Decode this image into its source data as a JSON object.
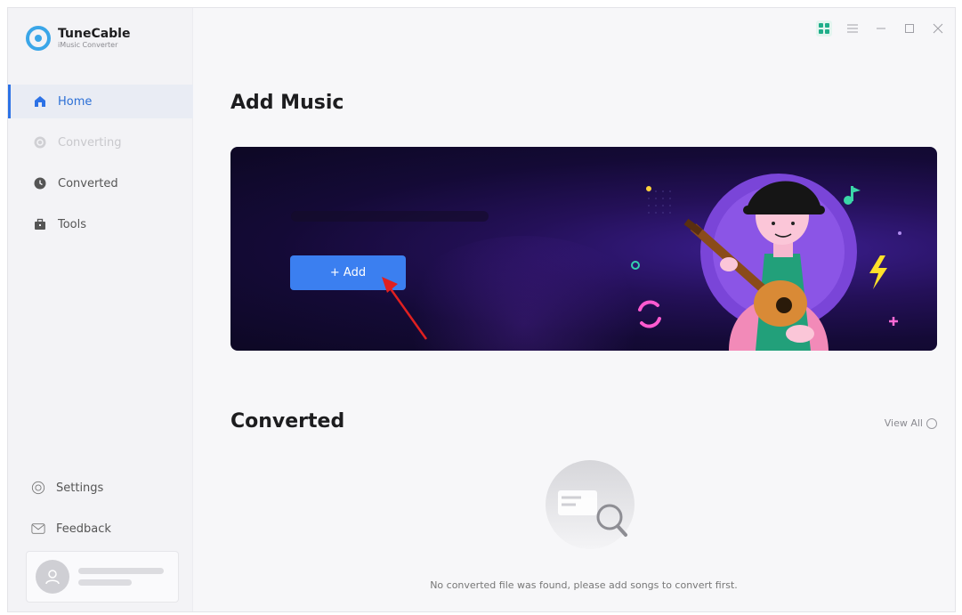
{
  "app": {
    "name": "TuneCable",
    "subtitle": "iMusic Converter"
  },
  "sidebar": {
    "items": [
      {
        "label": "Home",
        "icon": "home-icon",
        "state": "active"
      },
      {
        "label": "Converting",
        "icon": "converting-icon",
        "state": "disabled"
      },
      {
        "label": "Converted",
        "icon": "clock-icon",
        "state": "normal"
      },
      {
        "label": "Tools",
        "icon": "toolbox-icon",
        "state": "normal"
      }
    ],
    "bottom": [
      {
        "label": "Settings",
        "icon": "gear-icon"
      },
      {
        "label": "Feedback",
        "icon": "mail-icon"
      }
    ]
  },
  "main": {
    "add_title": "Add Music",
    "add_button": "+ Add",
    "converted_title": "Converted",
    "view_all": "View All",
    "empty_message": "No converted file was found, please add songs to convert first."
  },
  "colors": {
    "accent": "#3b7ff0",
    "active_text": "#2b6fd6",
    "banner_dark": "#140a36"
  }
}
